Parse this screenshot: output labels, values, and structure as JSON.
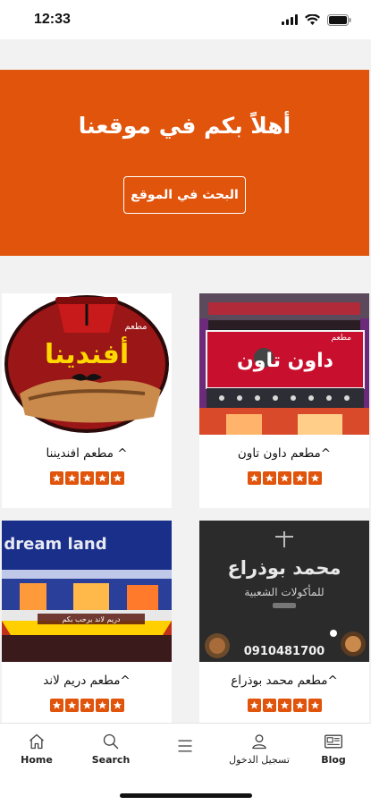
{
  "status_bar": {
    "time": "12:33"
  },
  "hero": {
    "title": "أهلاً بكم في موقعنا",
    "button_label": "البحث في الموقع"
  },
  "restaurants": [
    {
      "name": "^مطعم داون تاون",
      "rating": 5,
      "sign_text": "داون تاون",
      "sign_small": "مطعم"
    },
    {
      "name": "^ مطعم افنديننا",
      "rating": 5,
      "sign_text": "أفندينا",
      "sign_small": "مطعم"
    },
    {
      "name": "^مطعم محمد بوذراع",
      "rating": 5,
      "sign_text": "محمد بوذراع",
      "sign_sub": "للمأكولات الشعبية",
      "sign_phone": "0910481700"
    },
    {
      "name": "^مطعم دريم لاند",
      "rating": 5,
      "sign_text": "dream land",
      "sign_banner": "دريم لاند يرحب بكم"
    }
  ],
  "bottom_nav": {
    "items": [
      {
        "label": "Home",
        "icon": "home-icon"
      },
      {
        "label": "Search",
        "icon": "search-icon"
      },
      {
        "label": "",
        "icon": "menu-icon"
      },
      {
        "label": "تسجيل الدخول",
        "icon": "user-icon"
      },
      {
        "label": "Blog",
        "icon": "blog-icon"
      }
    ]
  },
  "colors": {
    "accent": "#e0540c",
    "background": "#f2f2f2"
  }
}
